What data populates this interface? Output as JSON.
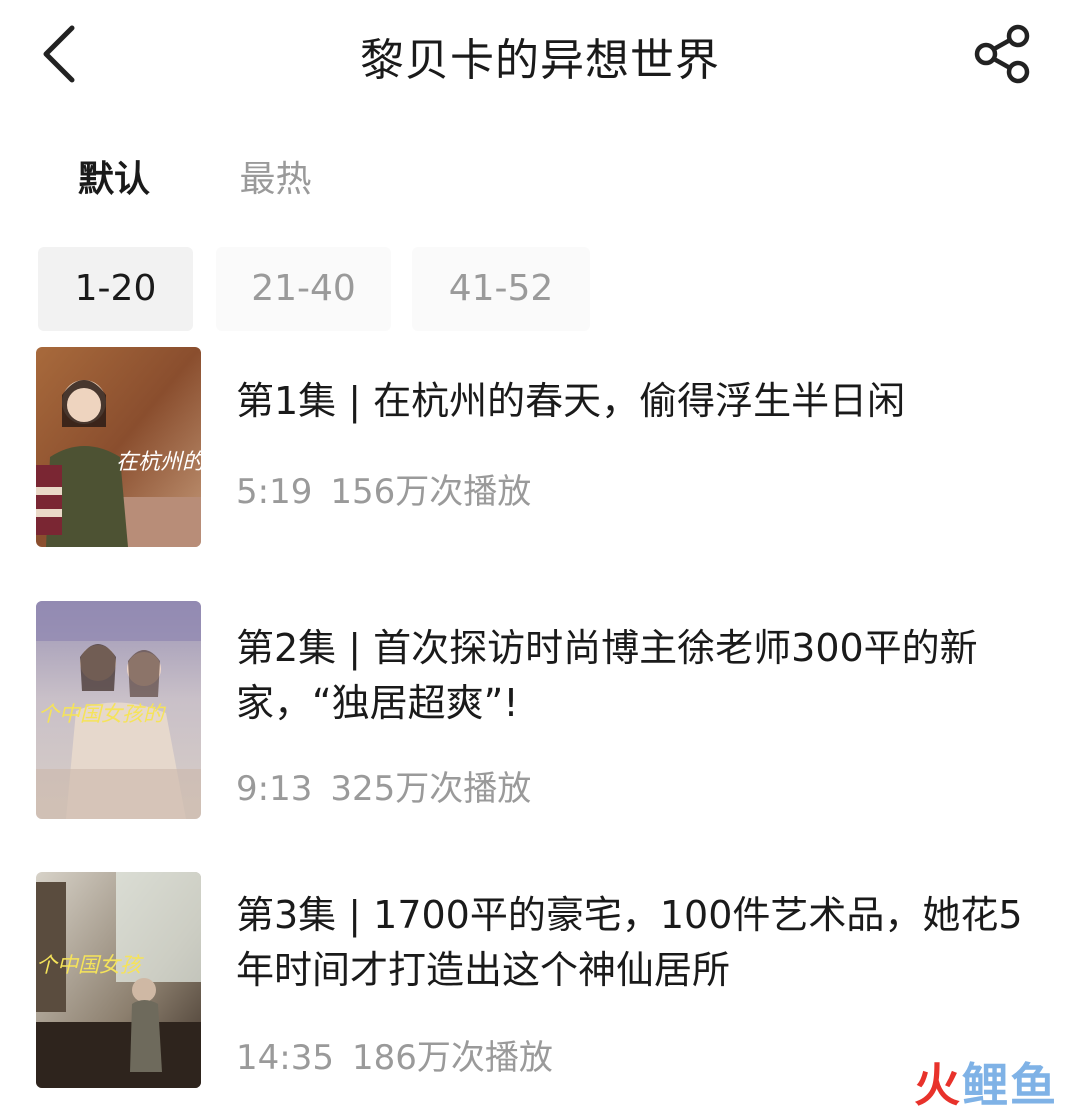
{
  "header": {
    "title": "黎贝卡的异想世界"
  },
  "sort_tabs": [
    {
      "label": "默认",
      "active": true
    },
    {
      "label": "最热",
      "active": false
    }
  ],
  "ranges": [
    {
      "label": "1-20",
      "selected": true
    },
    {
      "label": "21-40",
      "selected": false
    },
    {
      "label": "41-52",
      "selected": false
    }
  ],
  "episodes": [
    {
      "title": "第1集 | 在杭州的春天，偷得浮生半日闲",
      "duration": "5:19",
      "plays": "156万次播放",
      "thumb_text": "在杭州的"
    },
    {
      "title": "第2集 | 首次探访时尚博主徐老师300平的新家，“独居超爽”!",
      "duration": "9:13",
      "plays": "325万次播放",
      "thumb_text": "个中国女孩的"
    },
    {
      "title": "第3集 | 1700平的豪宅，100件艺术品，她花5年时间才打造出这个神仙居所",
      "duration": "14:35",
      "plays": "186万次播放",
      "thumb_text": "个中国女孩"
    }
  ],
  "watermark": {
    "fire": "火",
    "rest": "鲤鱼"
  },
  "icons": {
    "back": "chevron-left-icon",
    "share": "share-icon"
  }
}
